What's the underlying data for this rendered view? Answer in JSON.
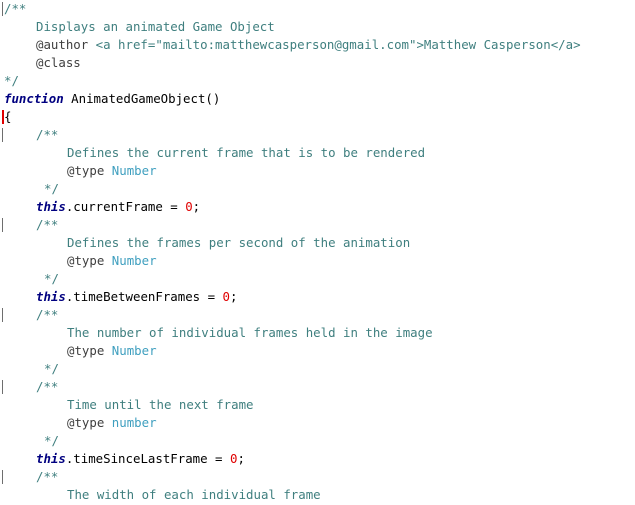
{
  "lines": [
    {
      "segs": [
        {
          "c": "c",
          "t": "/**"
        }
      ]
    },
    {
      "segs": [
        {
          "c": "c",
          "t": "Displays an animated Game Object"
        }
      ]
    },
    {
      "segs": [
        {
          "c": "dtag",
          "t": "@author"
        },
        {
          "c": "c",
          "t": " <a href=\"mailto:matthewcasperson@gmail.com\">Matthew Casperson</a>"
        }
      ]
    },
    {
      "segs": [
        {
          "c": "dtag",
          "t": "@class"
        }
      ]
    },
    {
      "segs": [
        {
          "c": "c",
          "t": "*/"
        }
      ]
    },
    {
      "segs": [
        {
          "c": "kwi",
          "t": "function"
        },
        {
          "c": "txt",
          "t": " AnimatedGameObject()"
        }
      ]
    },
    {
      "segs": [
        {
          "c": "txt",
          "t": "{"
        }
      ]
    },
    {
      "segs": [
        {
          "c": "c",
          "t": "/**"
        }
      ]
    },
    {
      "segs": [
        {
          "c": "c",
          "t": "Defines the current frame that is to be rendered"
        }
      ]
    },
    {
      "segs": [
        {
          "c": "dtag",
          "t": "@type"
        },
        {
          "c": "type",
          "t": " Number"
        }
      ]
    },
    {
      "segs": [
        {
          "c": "c",
          "t": "*/"
        }
      ]
    },
    {
      "segs": [
        {
          "c": "kwi",
          "t": "this"
        },
        {
          "c": "txt",
          "t": ".currentFrame = "
        },
        {
          "c": "num",
          "t": "0"
        },
        {
          "c": "txt",
          "t": ";"
        }
      ]
    },
    {
      "segs": [
        {
          "c": "c",
          "t": "/**"
        }
      ]
    },
    {
      "segs": [
        {
          "c": "c",
          "t": "Defines the frames per second of the animation"
        }
      ]
    },
    {
      "segs": [
        {
          "c": "dtag",
          "t": "@type"
        },
        {
          "c": "type",
          "t": " Number"
        }
      ]
    },
    {
      "segs": [
        {
          "c": "c",
          "t": "*/"
        }
      ]
    },
    {
      "segs": [
        {
          "c": "kwi",
          "t": "this"
        },
        {
          "c": "txt",
          "t": ".timeBetweenFrames = "
        },
        {
          "c": "num",
          "t": "0"
        },
        {
          "c": "txt",
          "t": ";"
        }
      ]
    },
    {
      "segs": [
        {
          "c": "c",
          "t": "/**"
        }
      ]
    },
    {
      "segs": [
        {
          "c": "c",
          "t": "The number of individual frames held in the image"
        }
      ]
    },
    {
      "segs": [
        {
          "c": "dtag",
          "t": "@type"
        },
        {
          "c": "type",
          "t": " Number"
        }
      ]
    },
    {
      "segs": [
        {
          "c": "c",
          "t": "*/"
        }
      ]
    },
    {
      "segs": [
        {
          "c": "c",
          "t": "/**"
        }
      ]
    },
    {
      "segs": [
        {
          "c": "c",
          "t": "Time until the next frame"
        }
      ]
    },
    {
      "segs": [
        {
          "c": "dtag",
          "t": "@type"
        },
        {
          "c": "type",
          "t": " number"
        }
      ]
    },
    {
      "segs": [
        {
          "c": "c",
          "t": "*/"
        }
      ]
    },
    {
      "segs": [
        {
          "c": "kwi",
          "t": "this"
        },
        {
          "c": "txt",
          "t": ".timeSinceLastFrame = "
        },
        {
          "c": "num",
          "t": "0"
        },
        {
          "c": "txt",
          "t": ";"
        }
      ]
    },
    {
      "segs": [
        {
          "c": "c",
          "t": "/**"
        }
      ]
    },
    {
      "segs": [
        {
          "c": "c",
          "t": "The width of each individual frame"
        }
      ]
    },
    {
      "segs": [
        {
          "c": "c",
          "t": " "
        }
      ]
    }
  ]
}
